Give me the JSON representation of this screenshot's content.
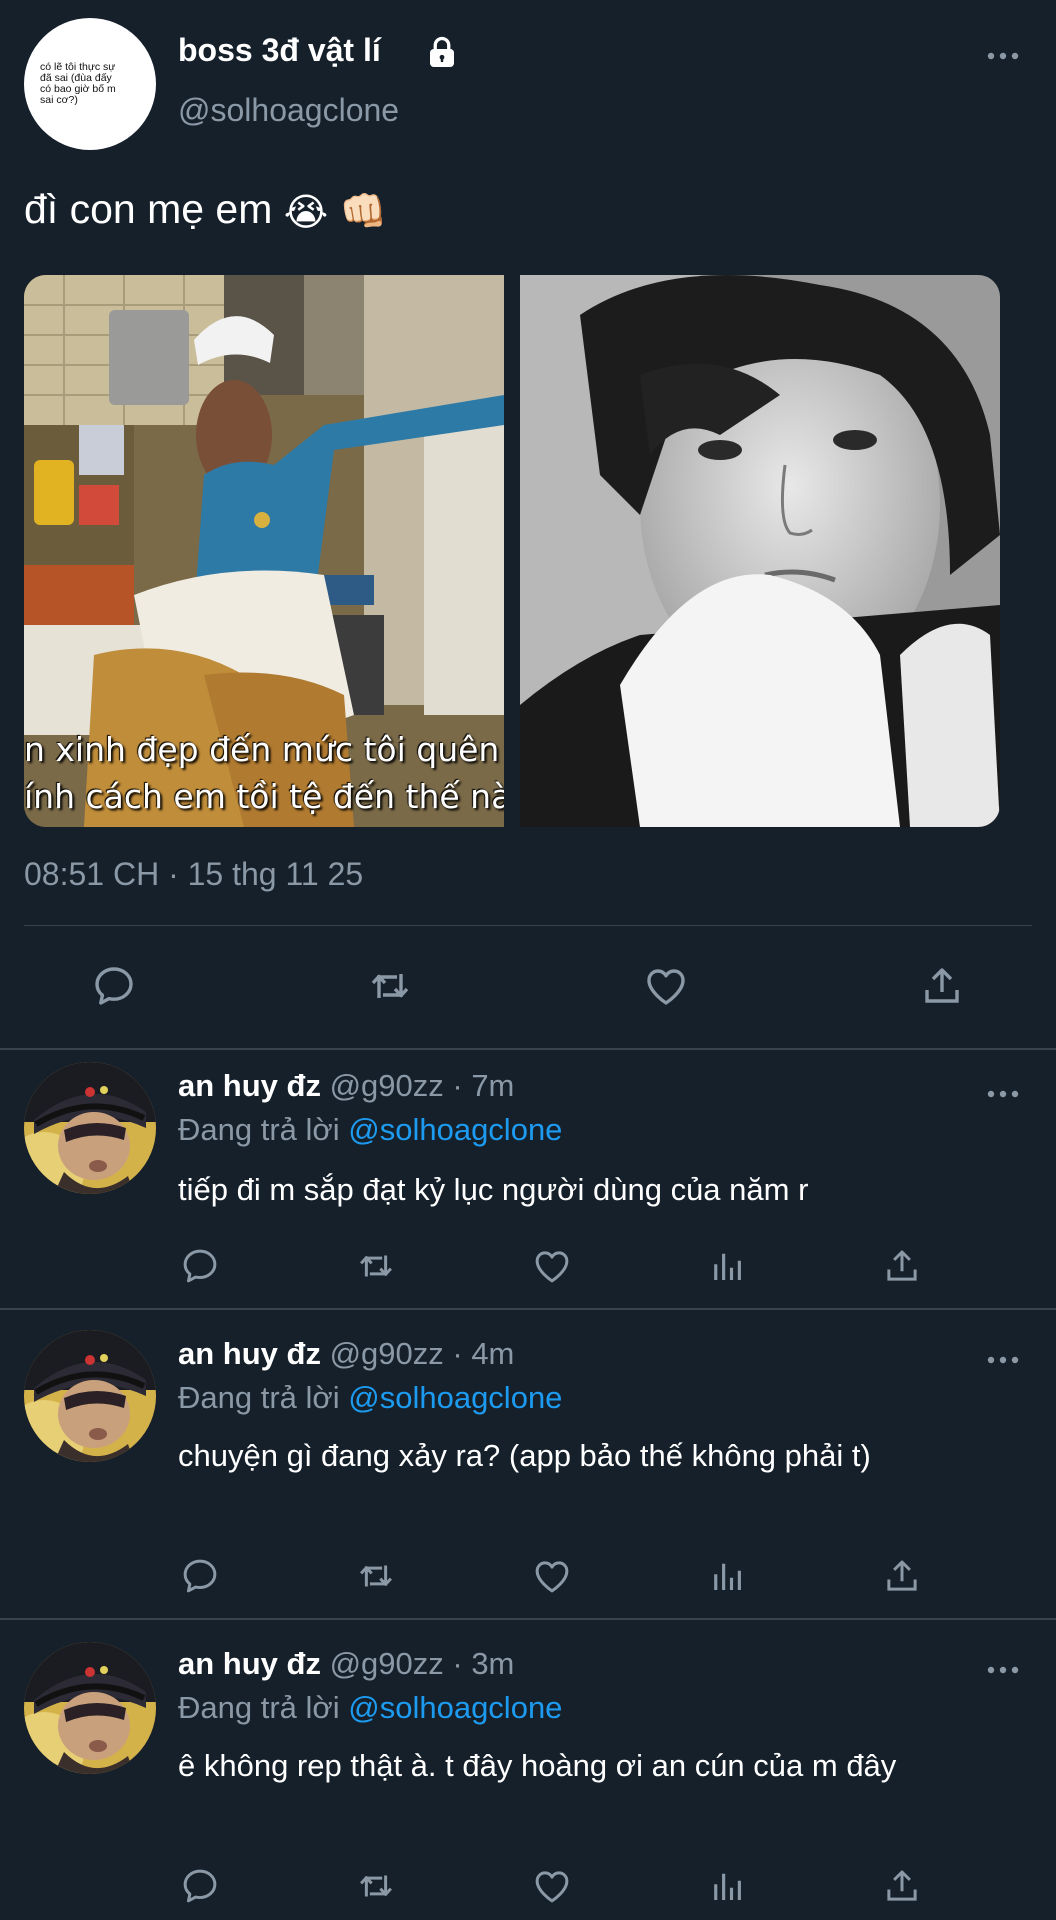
{
  "main_tweet": {
    "display_name": "boss 3đ vật lí",
    "handle": "@solhoagclone",
    "avatar_text": "có lẽ tôi thực sự\nđã sai (đùa đấy\ncó bao giờ bố m\nsai        cơ?)",
    "text": "đì con mẹ em",
    "emojis": [
      "😭",
      "👊🏻"
    ],
    "media": {
      "left_subtitle_line1": "n xinh đẹp đến mức tôi quên m",
      "left_subtitle_line2": "ính cách em tồi tệ đến thế nào."
    },
    "timestamp": "08:51 CH · 15 thg 11 25",
    "actions": [
      "reply-icon",
      "retweet-icon",
      "like-icon",
      "share-icon"
    ]
  },
  "replies": [
    {
      "name": "an huy đz",
      "handle": "@g90zz",
      "time": "7m",
      "meta": "@g90zz · 7m",
      "replying_prefix": "Đang trả lời",
      "replying_to": "@solhoagclone",
      "text": "tiếp đi m sắp đạt kỷ lục người dùng của năm r"
    },
    {
      "name": "an huy đz",
      "handle": "@g90zz",
      "time": "4m",
      "meta": "@g90zz · 4m",
      "replying_prefix": "Đang trả lời",
      "replying_to": "@solhoagclone",
      "text": "chuyện gì đang xảy ra? (app bảo thế không phải t)"
    },
    {
      "name": "an huy đz",
      "handle": "@g90zz",
      "time": "3m",
      "meta": "@g90zz · 3m",
      "replying_prefix": "Đang trả lời",
      "replying_to": "@solhoagclone",
      "text": "ê không rep thật à. t đây hoàng ơi an cún của m đây"
    }
  ],
  "reply_actions": [
    "reply-icon",
    "retweet-icon",
    "like-icon",
    "views-icon",
    "share-icon"
  ],
  "colors": {
    "background": "#15202b",
    "divider": "#38444d",
    "secondary_text": "#8b98a5",
    "link": "#1d9bf0",
    "icon": "#8b98a5"
  }
}
